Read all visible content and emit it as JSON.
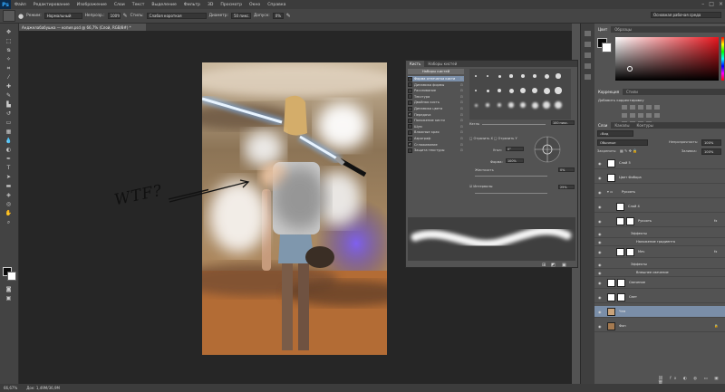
{
  "app": {
    "logo": "Ps"
  },
  "menu": [
    "Файл",
    "Редактирование",
    "Изображение",
    "Слои",
    "Текст",
    "Выделение",
    "Фильтр",
    "3D",
    "Просмотр",
    "Окно",
    "Справка"
  ],
  "options": {
    "mode_label": "Режим:",
    "mode_value": "Нормальный",
    "opacity_label": "Непрозр.:",
    "opacity_value": "100%",
    "smooth_label": "Стиль:",
    "smooth_value": "Слабая короткая",
    "diameter_label": "Диаметр:",
    "diameter_value": "50 пикс.",
    "tolerance_label": "Допуск:",
    "tolerance_value": "0%",
    "workspace": "Основная рабочая среда"
  },
  "document": {
    "tab_title": "Анджелабабушка — копия.psd @ 66,7% (Слой, RGB/8#) *",
    "zoom": "66,67%",
    "doc_info": "Док: 1,49М/36,9М"
  },
  "annotation": {
    "text": "WTF?"
  },
  "brush_panel": {
    "tabs": [
      "Кисть",
      "Наборы кистей"
    ],
    "presets_button": "Наборы кистей",
    "options": [
      {
        "label": "Форма отпечатка кисти",
        "checked": false,
        "active": true
      },
      {
        "label": "Динамика формы",
        "checked": false,
        "active": false
      },
      {
        "label": "Рассеивание",
        "checked": false,
        "active": false
      },
      {
        "label": "Текстура",
        "checked": false,
        "active": false
      },
      {
        "label": "Двойная кисть",
        "checked": false,
        "active": false
      },
      {
        "label": "Динамика цвета",
        "checked": false,
        "active": false
      },
      {
        "label": "Передача",
        "checked": true,
        "active": false
      },
      {
        "label": "Положение кисти",
        "checked": false,
        "active": false
      },
      {
        "label": "Шум",
        "checked": false,
        "active": false
      },
      {
        "label": "Влажные края",
        "checked": false,
        "active": false
      },
      {
        "label": "Аэрограф",
        "checked": false,
        "active": false
      },
      {
        "label": "Сглаживание",
        "checked": true,
        "active": false
      },
      {
        "label": "Защита текстуры",
        "checked": false,
        "active": false
      }
    ],
    "size_label": "Кегль",
    "size_value": "100 пикс.",
    "flip_x": "Отразить X",
    "flip_y": "Отразить Y",
    "angle_label": "Угол:",
    "angle_value": "0°",
    "roundness_label": "Форма:",
    "roundness_value": "100%",
    "hardness_label": "Жесткость",
    "hardness_value": "0%",
    "spacing_label": "Интервалы",
    "spacing_value": "25%"
  },
  "color_panel": {
    "tabs": [
      "Цвет",
      "Образцы"
    ]
  },
  "adjustments": {
    "tabs": [
      "Коррекция",
      "Стили"
    ],
    "title": "Добавить корректировку"
  },
  "layers_panel": {
    "tabs": [
      "Слои",
      "Каналы",
      "Контуры"
    ],
    "filter_label": "Вид",
    "blend_mode": "Обычные",
    "opacity_label": "Непрозрачность:",
    "opacity_value": "100%",
    "lock_label": "Закрепить:",
    "fill_label": "Заливка:",
    "fill_value": "100%",
    "layers": [
      {
        "name": "Слой 5",
        "kind": "layer"
      },
      {
        "name": "Цвет Фибора",
        "kind": "layer"
      },
      {
        "name": "Рукоять",
        "kind": "group"
      },
      {
        "name": "Слой 4",
        "kind": "layer"
      },
      {
        "name": "Рукоять",
        "kind": "layer",
        "fx": "fx"
      },
      {
        "name": "Эффекты",
        "kind": "effects"
      },
      {
        "name": "Наложение градиента",
        "kind": "effect"
      },
      {
        "name": "Меч",
        "kind": "layer",
        "fx": "fx"
      },
      {
        "name": "Эффекты",
        "kind": "effects"
      },
      {
        "name": "Внешнее свечение",
        "kind": "effect"
      },
      {
        "name": "Свечение",
        "kind": "layer"
      },
      {
        "name": "Свет",
        "kind": "layer"
      },
      {
        "name": "Чем",
        "kind": "layer"
      },
      {
        "name": "Фон",
        "kind": "background"
      }
    ]
  }
}
